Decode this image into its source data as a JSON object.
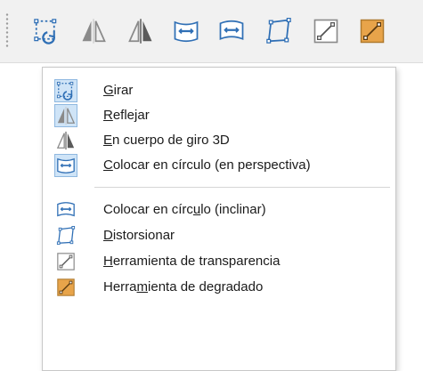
{
  "toolbar": {
    "buttons": [
      {
        "icon": "rotate-icon",
        "label": "Girar"
      },
      {
        "icon": "flip-icon",
        "label": "Reflejar"
      },
      {
        "icon": "3d-rotation-object-icon",
        "label": "En cuerpo de giro 3D"
      },
      {
        "icon": "circle-perspective-icon",
        "label": "Colocar en círculo (en perspectiva)"
      },
      {
        "icon": "circle-slant-icon",
        "label": "Colocar en círculo (inclinar)"
      },
      {
        "icon": "distort-icon",
        "label": "Distorsionar"
      },
      {
        "icon": "transparency-tool-icon",
        "label": "Herramienta de transparencia"
      },
      {
        "icon": "gradient-tool-icon",
        "label": "Herramienta de degradado"
      }
    ]
  },
  "menu": {
    "items": [
      {
        "label_pre": "",
        "mnemonic": "G",
        "label_post": "irar",
        "icon": "rotate-icon",
        "checked": true
      },
      {
        "label_pre": "",
        "mnemonic": "R",
        "label_post": "eflejar",
        "icon": "flip-icon",
        "checked": true
      },
      {
        "label_pre": "",
        "mnemonic": "E",
        "label_post": "n cuerpo de giro 3D",
        "icon": "3d-rotation-object-icon",
        "checked": false
      },
      {
        "label_pre": "",
        "mnemonic": "C",
        "label_post": "olocar en círculo (en perspectiva)",
        "icon": "circle-perspective-icon",
        "checked": true
      },
      {
        "label_pre": "Colocar en círc",
        "mnemonic": "u",
        "label_post": "lo (inclinar)",
        "icon": "circle-slant-icon",
        "checked": false
      },
      {
        "label_pre": "",
        "mnemonic": "D",
        "label_post": "istorsionar",
        "icon": "distort-icon",
        "checked": false
      },
      {
        "label_pre": "",
        "mnemonic": "H",
        "label_post": "erramienta de transparencia",
        "icon": "transparency-tool-icon",
        "checked": false
      },
      {
        "label_pre": "Herra",
        "mnemonic": "m",
        "label_post": "ienta de degradado",
        "icon": "gradient-tool-icon",
        "checked": false
      }
    ]
  },
  "colors": {
    "icon_blue": "#2f6fb5",
    "icon_gray": "#8a8a8a",
    "gradient_orange": "#e8a44a",
    "checked_bg": "#cfe4f7"
  }
}
